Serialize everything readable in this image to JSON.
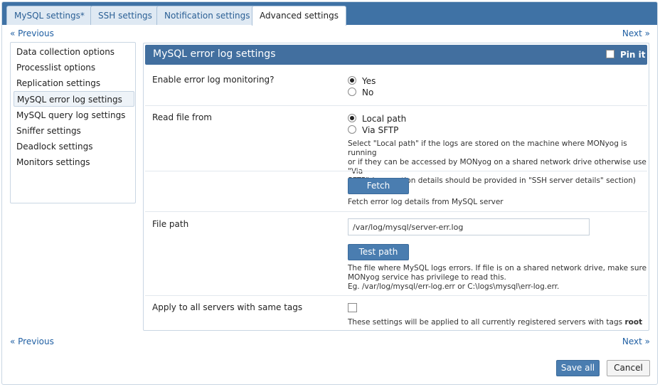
{
  "tabs": [
    {
      "label": "MySQL settings*",
      "active": false
    },
    {
      "label": "SSH settings",
      "active": false
    },
    {
      "label": "Notification settings",
      "active": false
    },
    {
      "label": "Advanced settings",
      "active": true
    }
  ],
  "nav": {
    "previous": "« Previous",
    "next": "Next »"
  },
  "sidebar": {
    "items": [
      {
        "label": "Data collection options",
        "active": false
      },
      {
        "label": "Processlist options",
        "active": false
      },
      {
        "label": "Replication settings",
        "active": false
      },
      {
        "label": "MySQL error log settings",
        "active": true
      },
      {
        "label": "MySQL query log settings",
        "active": false
      },
      {
        "label": "Sniffer settings",
        "active": false
      },
      {
        "label": "Deadlock settings",
        "active": false
      },
      {
        "label": "Monitors settings",
        "active": false
      }
    ]
  },
  "panel": {
    "title": "MySQL error log settings",
    "pin_label": "Pin it",
    "enable": {
      "label": "Enable error log monitoring?",
      "yes": "Yes",
      "no": "No",
      "selected": "Yes"
    },
    "read_from": {
      "label": "Read file from",
      "local": "Local path",
      "sftp": "Via SFTP",
      "selected": "Local path",
      "help1": "Select \"Local path\" if the logs are stored on the machine where MONyog is running",
      "help2": "or if they can be accessed by MONyog on a shared network drive otherwise use \"Via",
      "help3": "SFTP\" (connection details should be provided in \"SSH server details\" section)"
    },
    "fetch": {
      "button": "Fetch",
      "help": "Fetch error log details from MySQL server"
    },
    "file_path": {
      "label": "File path",
      "value": "/var/log/mysql/server-err.log",
      "test_button": "Test path",
      "help1": "The file where MySQL logs errors. If file is on a shared network drive, make sure",
      "help2": "MONyog service has privilege to read this.",
      "help3": "Eg. /var/log/mysql/err-log.err or C:\\logs\\mysql\\err-log.err."
    },
    "apply": {
      "label": "Apply to all servers with same tags",
      "help_prefix": "These settings will be applied to all currently registered servers with tags",
      "tag": "root"
    }
  },
  "footer": {
    "save": "Save all",
    "cancel": "Cancel"
  }
}
